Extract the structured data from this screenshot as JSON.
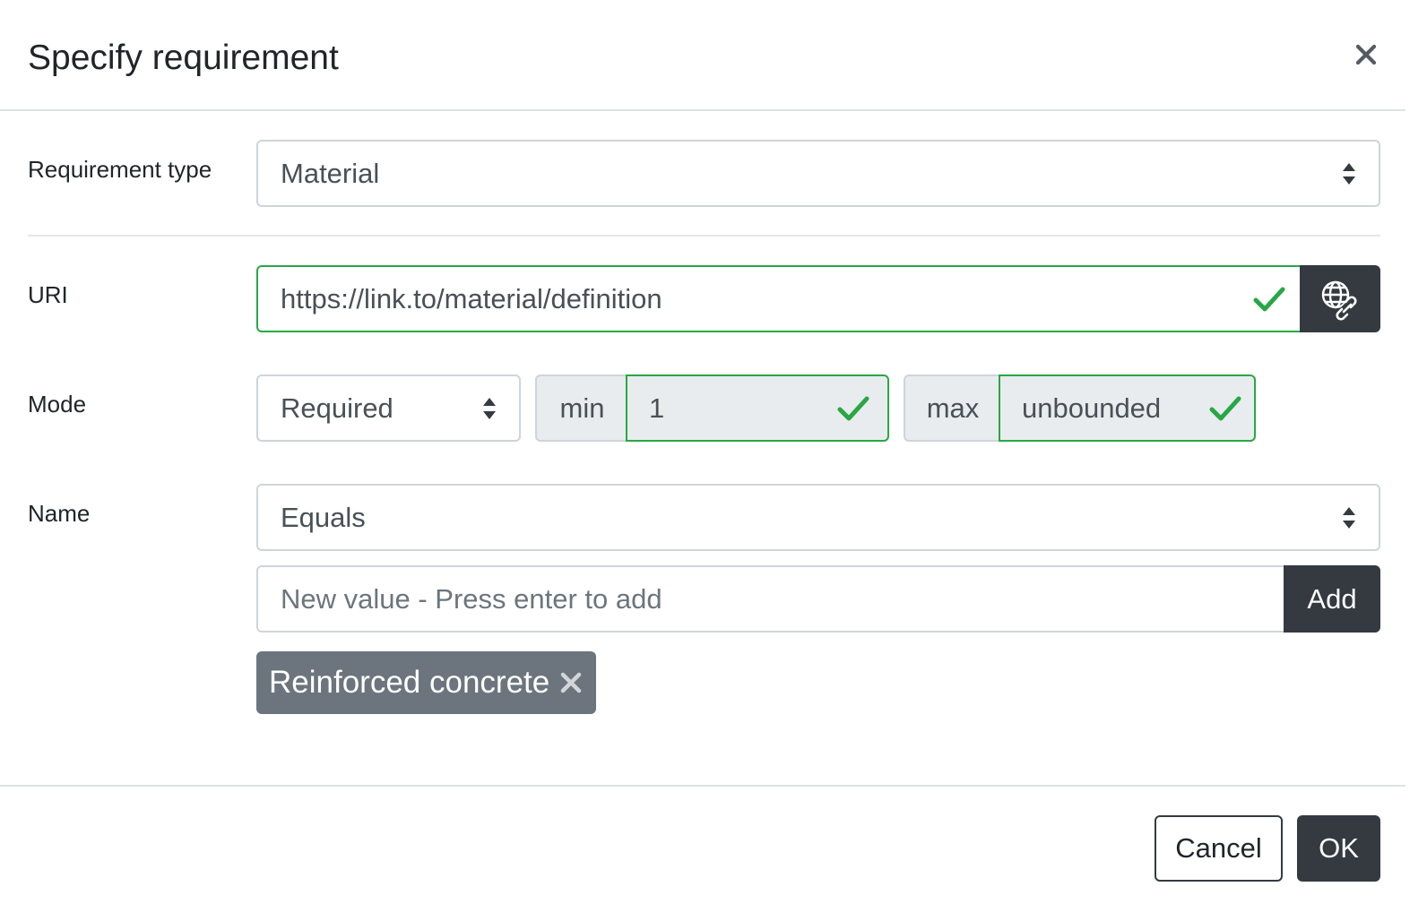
{
  "dialog": {
    "title": "Specify requirement"
  },
  "form": {
    "requirement_type": {
      "label": "Requirement type",
      "selected": "Material"
    },
    "uri": {
      "label": "URI",
      "value": "https://link.to/material/definition",
      "valid": true
    },
    "mode": {
      "label": "Mode",
      "selected": "Required",
      "min_label": "min",
      "min_value": "1",
      "max_label": "max",
      "max_value": "unbounded"
    },
    "name": {
      "label": "Name",
      "operator": "Equals",
      "new_value_placeholder": "New value - Press enter to add",
      "add_label": "Add",
      "values": [
        "Reinforced concrete"
      ]
    }
  },
  "footer": {
    "cancel_label": "Cancel",
    "ok_label": "OK"
  },
  "colors": {
    "valid": "#28a745",
    "dark": "#343a40",
    "tag": "#6c757d",
    "addon_bg": "#e9ecef"
  },
  "icons": {
    "close": "close-icon",
    "select_arrows": "sort-arrows-icon",
    "check": "check-icon",
    "link": "globe-link-icon",
    "remove_tag": "remove-x-icon"
  }
}
